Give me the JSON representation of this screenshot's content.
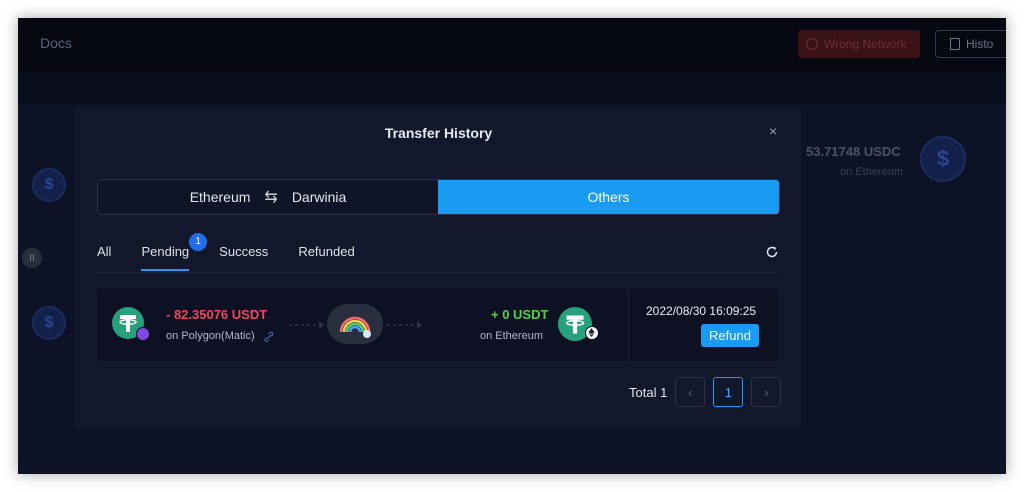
{
  "topbar": {
    "docs_label": "Docs",
    "wrong_network_label": "Wrong Network",
    "history_label": "Histo"
  },
  "background": {
    "usdc_amount": "53.71748 USDC",
    "on_chain": "on Ethereum"
  },
  "modal": {
    "title": "Transfer History",
    "close_glyph": "×",
    "direction_tabs": {
      "from_chain": "Ethereum",
      "swap_glyph": "⇆",
      "to_chain": "Darwinia",
      "others_label": "Others"
    },
    "status_tabs": [
      {
        "label": "All",
        "active": false
      },
      {
        "label": "Pending",
        "active": true,
        "badge": "1"
      },
      {
        "label": "Success",
        "active": false
      },
      {
        "label": "Refunded",
        "active": false
      }
    ],
    "record": {
      "from_amount": "- 82.35076 USDT",
      "from_network": "on Polygon(Matic)",
      "to_amount": "+ 0 USDT",
      "to_network": "on Ethereum",
      "timestamp": "2022/08/30 16:09:25",
      "refund_label": "Refund"
    },
    "pagination": {
      "total_label": "Total 1",
      "prev_glyph": "‹",
      "current_page": "1",
      "next_glyph": "›"
    }
  },
  "colors": {
    "accent": "#1a9bf3",
    "negative": "#f0485c",
    "positive": "#55cf4c",
    "tether": "#26a17b",
    "polygon": "#8247e5"
  }
}
